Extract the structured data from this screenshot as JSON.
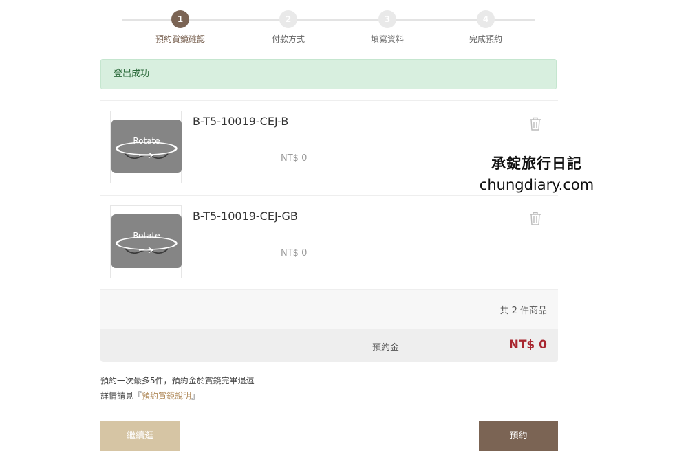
{
  "stepper": {
    "steps": [
      {
        "number": "1",
        "label": "預約賞鏡確認",
        "active": true
      },
      {
        "number": "2",
        "label": "付款方式",
        "active": false
      },
      {
        "number": "3",
        "label": "填寫資料",
        "active": false
      },
      {
        "number": "4",
        "label": "完成預約",
        "active": false
      }
    ]
  },
  "alert": {
    "text": "登出成功"
  },
  "items": [
    {
      "sku": "B-T5-10019-CEJ-B",
      "price": "NT$ 0",
      "thumb_text": "Rotate",
      "icon": "trash-icon"
    },
    {
      "sku": "B-T5-10019-CEJ-GB",
      "price": "NT$ 0",
      "thumb_text": "Rotate",
      "icon": "trash-icon"
    }
  ],
  "summary": {
    "count_text": "共 2 件商品",
    "deposit_label": "預約金",
    "deposit_value": "NT$ 0"
  },
  "notes": {
    "line1": "預約一次最多5件，預約金於賞鏡完畢退還",
    "line2_prefix": "詳情請見『",
    "line2_link": "預約賞鏡說明",
    "line2_suffix": "』"
  },
  "buttons": {
    "continue": "繼續逛",
    "reserve": "預約"
  },
  "watermark": {
    "line1": "承錠旅行日記",
    "line2": "chungdiary.com"
  },
  "colors": {
    "brand": "#7b6454",
    "accent_light": "#d6c5a4",
    "price_red": "#a8262f",
    "success_bg": "#d8efdf"
  }
}
